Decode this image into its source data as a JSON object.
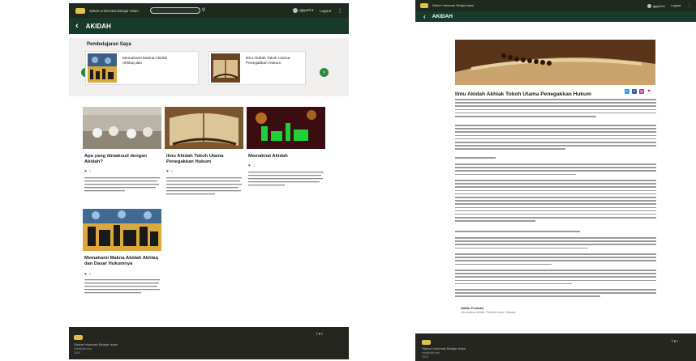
{
  "left": {
    "header": {
      "brand": "Sistem Informasi Belajar Islam",
      "user": "gqyurti ▾",
      "logout": "Logout"
    },
    "subheader": {
      "back": "‹",
      "title": "AKIDAH"
    },
    "learning": {
      "title": "Pembelajaran Saya",
      "cards": [
        {
          "title": "Memahami Makna Akidah Akhlaq dan"
        },
        {
          "title": "Ilmu Akidah Tokoh Utama Penegakkan Hukum"
        }
      ],
      "prev": "‹",
      "next": "›"
    },
    "topics": [
      {
        "title": "Apa yang dimaksud dengan Akidah?",
        "likes": "1"
      },
      {
        "title": "Ilmu Akidah Tokoh Utama Penegakkan Hukum",
        "likes": "1"
      },
      {
        "title": "Memaknai Akidah",
        "likes": "1"
      },
      {
        "title": "Memahami Makna Akidah Akhlaq dan Dasar Hukumnya",
        "likes": "1"
      }
    ],
    "footer": {
      "line1": "Sistem Informasi Belajar Islam",
      "line2": "info@sibi.com",
      "line3": "2019",
      "social": "f  ♥  t"
    }
  },
  "right": {
    "header": {
      "brand": "Sistem Informasi Belajar Islam",
      "user": "gqyurti ▾",
      "logout": "Logout"
    },
    "subheader": {
      "back": "‹",
      "title": "AKIDAH"
    },
    "article": {
      "title": "Ilmu Akidah Akhlak Tokoh Utama Penegakkan Hukum",
      "sources_title": "Daftar Pustaka",
      "sources_line": "Ilmu Akidah Akhlak. Penerbit Islam, Jakarta."
    },
    "share_colors": {
      "twitter": "#1da1f2",
      "facebook": "#3b5998",
      "instagram": "#c13584",
      "like": "#d4253a"
    },
    "footer": {
      "line1": "Sistem Informasi Belajar Islam",
      "line2": "info@sibi.com",
      "line3": "2019",
      "social": "f  ♥  t"
    }
  }
}
